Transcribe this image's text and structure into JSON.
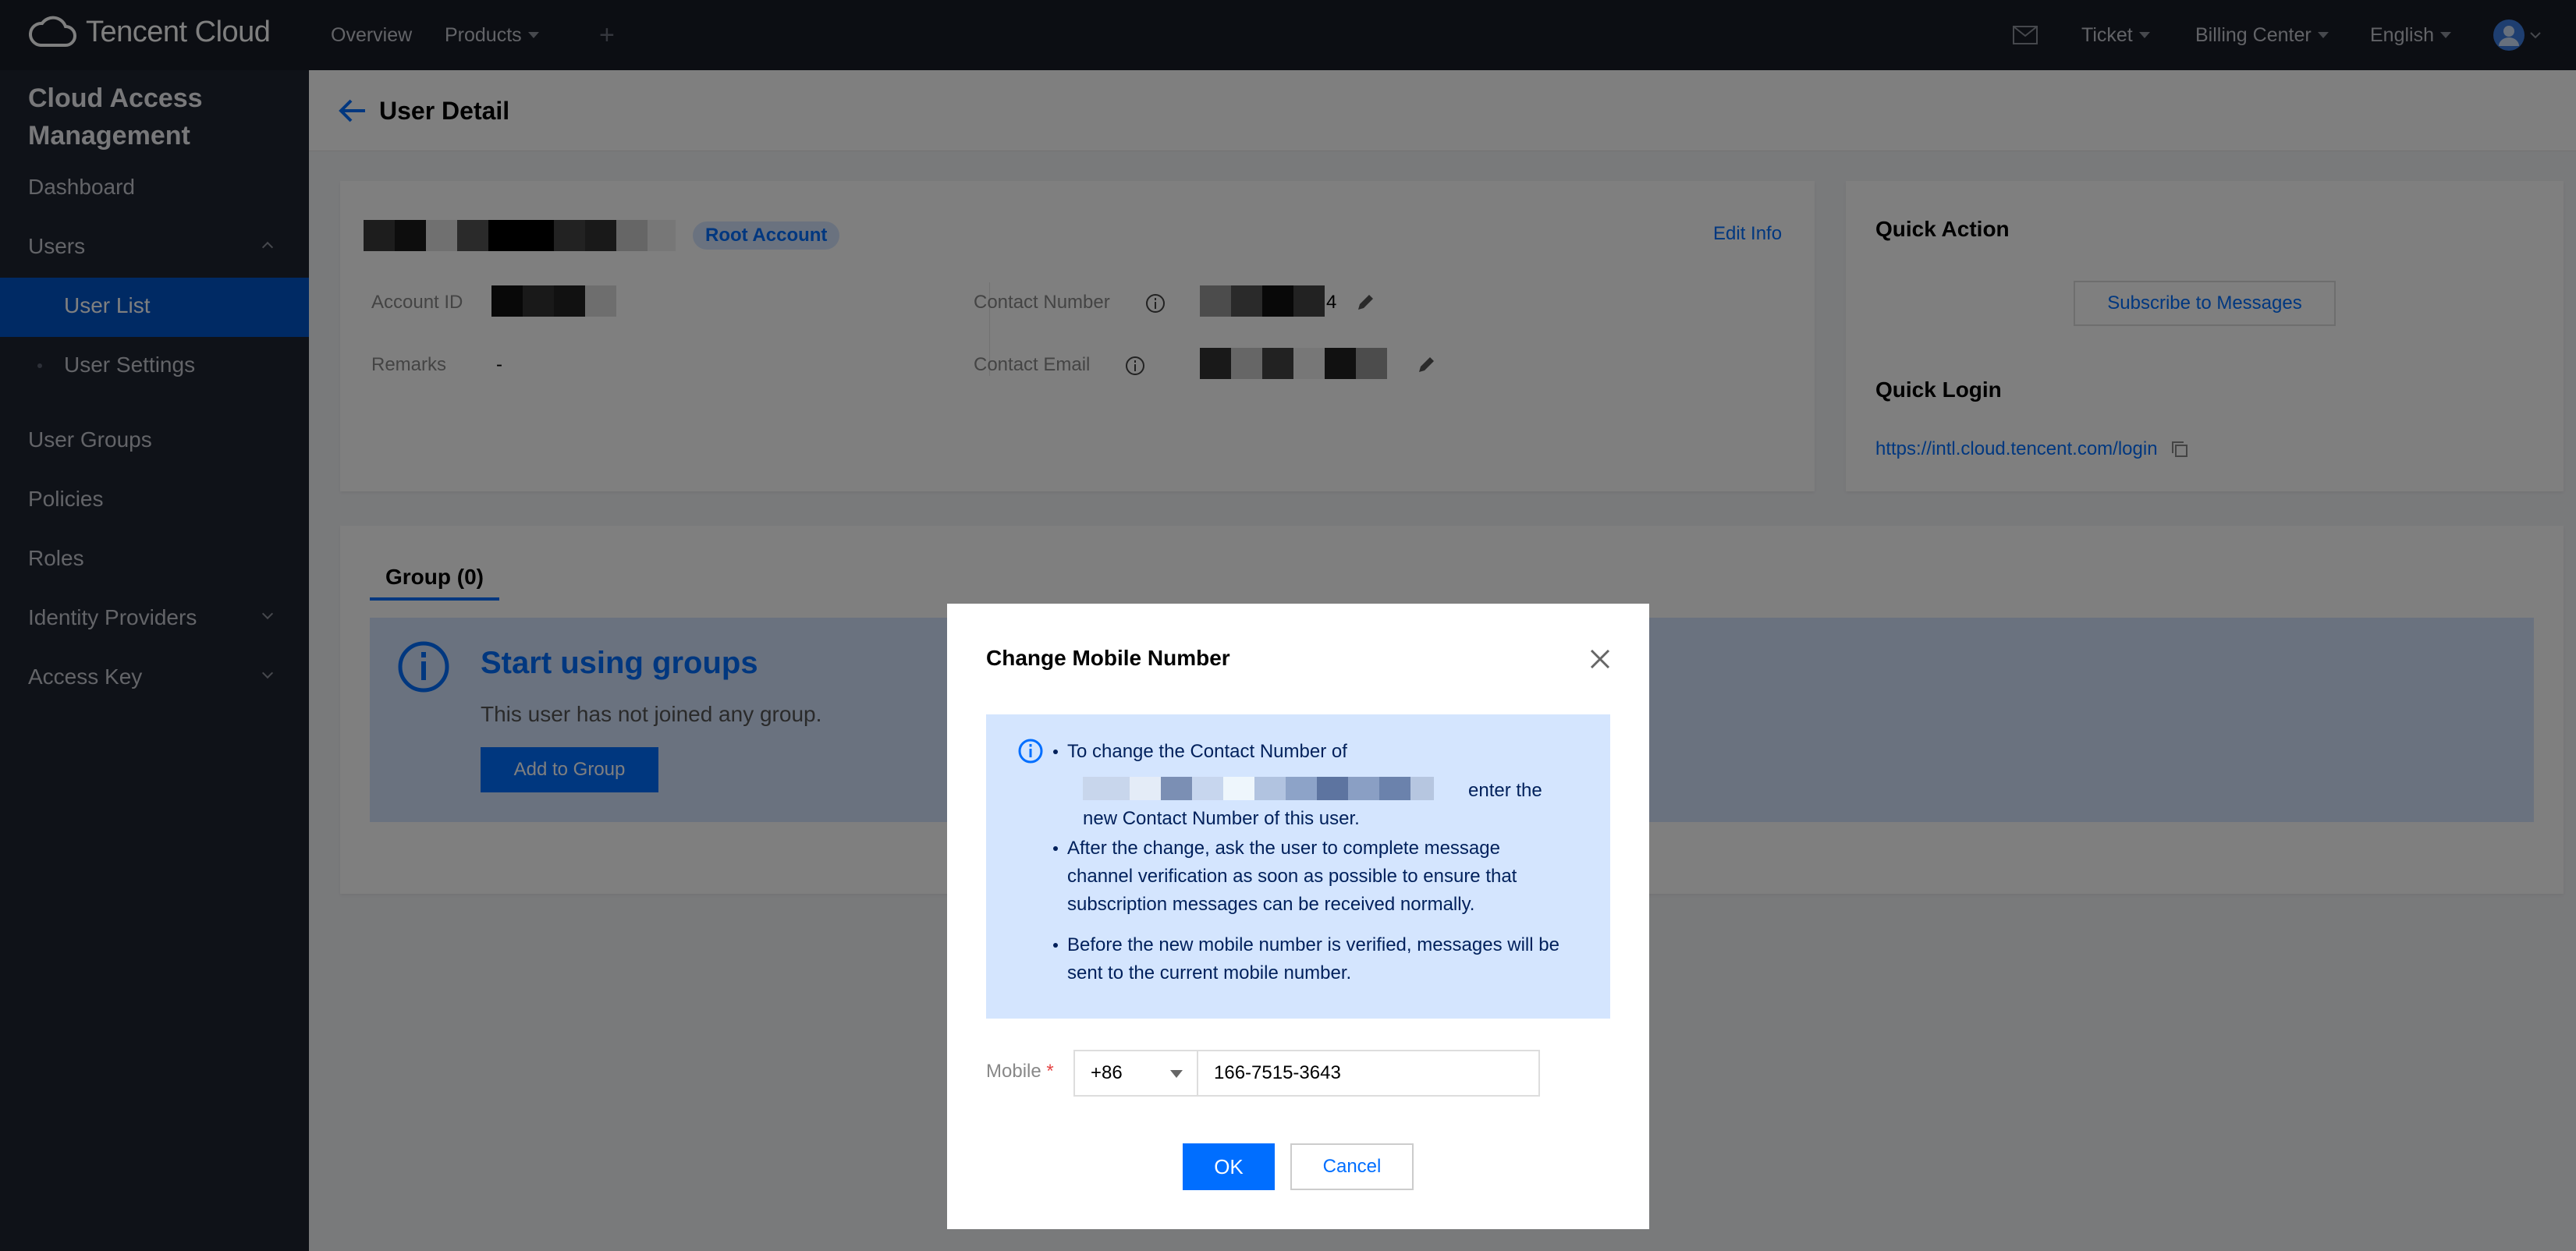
{
  "topbar": {
    "brand": "Tencent Cloud",
    "nav": [
      "Overview",
      "Products"
    ],
    "right": [
      "Ticket",
      "Billing Center",
      "English"
    ]
  },
  "sidebar": {
    "title": "Cloud Access Management",
    "items": [
      "Dashboard",
      "Users",
      "User List",
      "User Settings",
      "User Groups",
      "Policies",
      "Roles",
      "Identity Providers",
      "Access Key"
    ]
  },
  "page": {
    "title": "User Detail",
    "root_badge": "Root Account",
    "edit_info": "Edit Info",
    "account_id_label": "Account ID",
    "remarks_label": "Remarks",
    "remarks_value": "-",
    "contact_number_label": "Contact Number",
    "contact_number_suffix": "4",
    "contact_email_label": "Contact Email",
    "quick_action_title": "Quick Action",
    "subscribe_button": "Subscribe to Messages",
    "quick_login_title": "Quick Login",
    "quick_login_url": "https://intl.cloud.tencent.com/login",
    "group_tab": "Group (0)",
    "start_groups_title": "Start using groups",
    "start_groups_desc": "This user has not joined any group.",
    "add_to_group": "Add to Group"
  },
  "dialog": {
    "title": "Change Mobile Number",
    "bullet1_line1": "To change the Contact Number of",
    "bullet1_tail": "enter the",
    "bullet1_line3": "new Contact Number of this user.",
    "bullet2": "After the change, ask the user to complete message channel verification as soon as possible to ensure that subscription messages can be received normally.",
    "bullet3": "Before the new mobile number is verified, messages will be sent to the current mobile number.",
    "mobile_label": "Mobile",
    "required_mark": "*",
    "country_code": "+86",
    "phone_value": "166-7515-3643",
    "ok": "OK",
    "cancel": "Cancel"
  },
  "colors": {
    "primary": "#006eff",
    "topbar": "#181c26",
    "sidebar": "#1f2430",
    "sidebar_active": "#0055c9",
    "notice_bg": "#d4e5fe"
  }
}
